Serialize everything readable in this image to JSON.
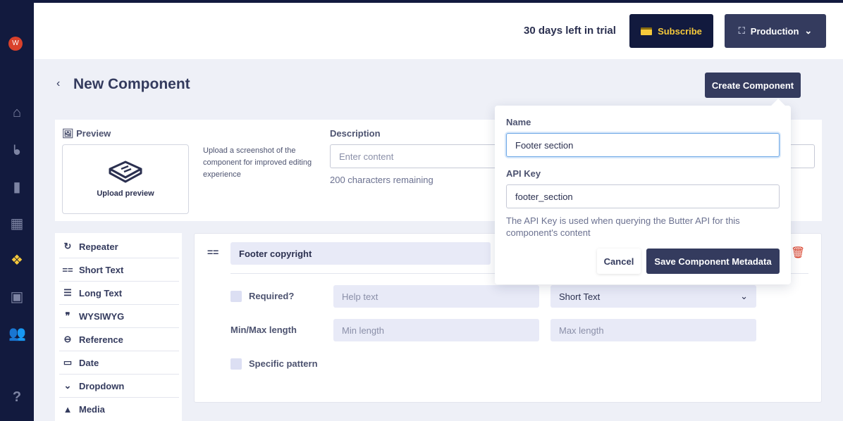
{
  "sidebar": {
    "avatar": "W",
    "items": [
      "home-icon",
      "blog-icon",
      "page-icon",
      "collection-icon",
      "components-icon",
      "media-icon",
      "users-icon"
    ],
    "help": "?",
    "active_color": "#f6c93b"
  },
  "header": {
    "trial": "30 days left in trial",
    "subscribe": "Subscribe",
    "environment": "Production"
  },
  "page": {
    "back": "‹",
    "title": "New Component",
    "create": "Create Component"
  },
  "preview": {
    "label": "Preview",
    "upload": "Upload preview",
    "hint": "Upload a screenshot of the component for improved editing experience",
    "description_label": "Description",
    "description_placeholder": "Enter content",
    "chars_remaining": "200 characters remaining"
  },
  "field_types": [
    {
      "icon": "↻",
      "label": "Repeater"
    },
    {
      "icon": "==",
      "label": "Short Text"
    },
    {
      "icon": "☰",
      "label": "Long Text"
    },
    {
      "icon": "❞",
      "label": "WYSIWYG"
    },
    {
      "icon": "⊖",
      "label": "Reference"
    },
    {
      "icon": "▭",
      "label": "Date"
    },
    {
      "icon": "⌄",
      "label": "Dropdown"
    },
    {
      "icon": "▲",
      "label": "Media"
    }
  ],
  "field": {
    "name": "Footer copyright",
    "required": "Required?",
    "help_placeholder": "Help text",
    "type": "Short Text",
    "minmax_label": "Min/Max length",
    "min_placeholder": "Min length",
    "max_placeholder": "Max length",
    "pattern": "Specific pattern"
  },
  "popover": {
    "name_label": "Name",
    "name_value": "Footer section",
    "api_label": "API Key",
    "api_value": "footer_section",
    "help": "The API Key is used when querying the Butter API for this component's content",
    "cancel": "Cancel",
    "save": "Save Component Metadata"
  }
}
